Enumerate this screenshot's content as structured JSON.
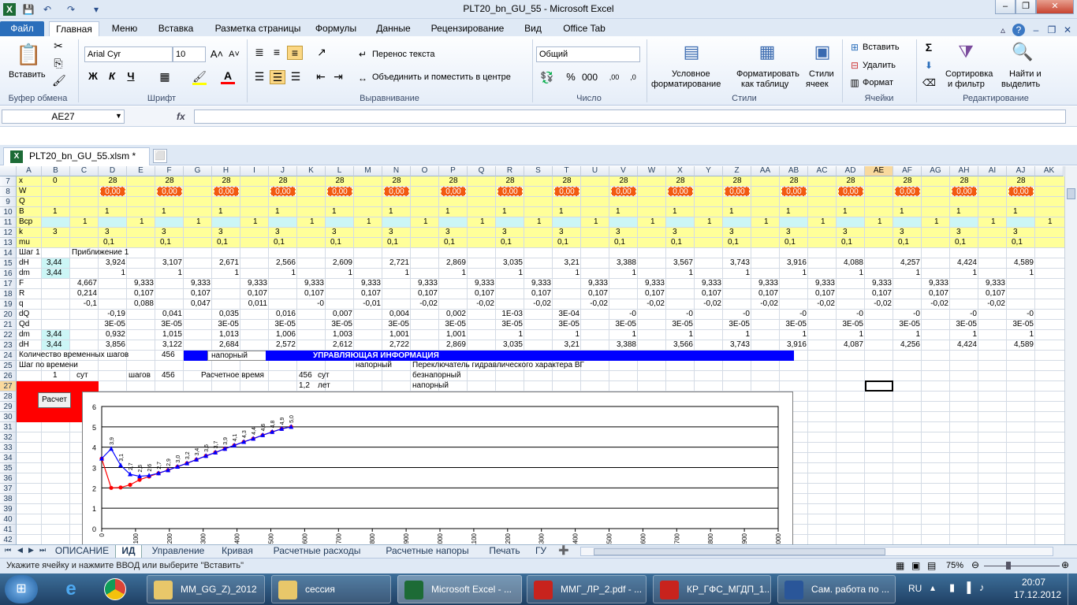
{
  "window": {
    "title": "PLT20_bn_GU_55 - Microsoft Excel"
  },
  "ribbon_tabs": [
    "Файл",
    "Главная",
    "Меню",
    "Вставка",
    "Разметка страницы",
    "Формулы",
    "Данные",
    "Рецензирование",
    "Вид",
    "Office Tab"
  ],
  "ribbon": {
    "paste": "Вставить",
    "font_name": "Arial Cyr",
    "font_size": "10",
    "bold": "Ж",
    "italic": "К",
    "underline": "Ч",
    "wrap_text": "Перенос текста",
    "merge_center": "Объединить и поместить в центре",
    "number_format": "Общий",
    "cond_format": [
      "Условное",
      "форматирование"
    ],
    "format_table": [
      "Форматировать",
      "как таблицу"
    ],
    "cell_styles": [
      "Стили",
      "ячеек"
    ],
    "insert": "Вставить",
    "delete": "Удалить",
    "format": "Формат",
    "sort_filter": [
      "Сортировка",
      "и фильтр"
    ],
    "find_select": [
      "Найти и",
      "выделить"
    ],
    "groups": [
      "Буфер обмена",
      "Шрифт",
      "Выравнивание",
      "Число",
      "Стили",
      "Ячейки",
      "Редактирование"
    ]
  },
  "formula_bar": {
    "name_box": "AE27",
    "fx": "fx",
    "value": ""
  },
  "doc_tab": {
    "label": "PLT20_bn_GU_55.xlsm *"
  },
  "columns": [
    "A",
    "B",
    "C",
    "D",
    "E",
    "F",
    "G",
    "H",
    "I",
    "J",
    "K",
    "L",
    "M",
    "N",
    "O",
    "P",
    "Q",
    "R",
    "S",
    "T",
    "U",
    "V",
    "W",
    "X",
    "Y",
    "Z",
    "AA",
    "AB",
    "AC",
    "AD",
    "AE",
    "AF",
    "AG",
    "AH",
    "AI",
    "AJ",
    "AK"
  ],
  "rows": [
    "7",
    "8",
    "9",
    "10",
    "11",
    "12",
    "13",
    "14",
    "15",
    "16",
    "17",
    "18",
    "19",
    "20",
    "21",
    "22",
    "23",
    "24",
    "25",
    "26",
    "27",
    "28",
    "29",
    "30",
    "31",
    "32",
    "33",
    "34",
    "35",
    "36",
    "37",
    "38",
    "39",
    "40",
    "41",
    "42",
    "43"
  ],
  "row_labels": {
    "r7": "x",
    "r8": "W",
    "r9": "Q",
    "r10": "B",
    "r11": "Bcp",
    "r12": "k",
    "r13": "mu",
    "r14": "Шаг 1",
    "r15": "dH",
    "r16": "dm",
    "r17": "F",
    "r18": "R",
    "r19": "q",
    "r20": "dQ",
    "r21": "Qd",
    "r22": "dm",
    "r23": "dH",
    "r24": "Количество временных шагов",
    "r25": "Шаг по времени"
  },
  "cells": {
    "x_b": "0",
    "x_val": "28",
    "w_val": "0,00",
    "b_val": "1",
    "bcp_val": "1",
    "k_val": "3",
    "mu_val": "0,1",
    "approx": "Приближение 1",
    "b15": "3,44",
    "b16": "3,44",
    "b22": "3,44",
    "b23": "3,44",
    "steps_count": "456",
    "dropdown": "напорный",
    "control_header": "УПРАВЛЯЮЩАЯ ИНФОРМАЦИЯ",
    "r25_n": "напорный",
    "r25_p": "Переключатель гидравлического характера ВГ",
    "r26_b": "1",
    "r26_c": "сут",
    "r26_e": "шагов",
    "r26_f": "456",
    "r26_h": "Расчетное время",
    "r26_k": "456",
    "r26_l": "сут",
    "r26_p": "безнапорный",
    "r27_k": "1,2",
    "r27_l": "лет",
    "r27_p": "напорный",
    "calc_button": "Расчет"
  },
  "row15": [
    "3,924",
    "3,107",
    "2,671",
    "2,566",
    "2,609",
    "2,721",
    "2,869",
    "3,035",
    "3,21",
    "3,388",
    "3,567",
    "3,743",
    "3,916",
    "4,088",
    "4,257",
    "4,424",
    "4,589"
  ],
  "row16": [
    "1",
    "1",
    "1",
    "1",
    "1",
    "1",
    "1",
    "1",
    "1",
    "1",
    "1",
    "1",
    "1",
    "1",
    "1",
    "1",
    "1"
  ],
  "row17": [
    "4,667",
    "9,333",
    "9,333",
    "9,333",
    "9,333",
    "9,333",
    "9,333",
    "9,333",
    "9,333",
    "9,333",
    "9,333",
    "9,333",
    "9,333",
    "9,333",
    "9,333",
    "9,333",
    "9,333"
  ],
  "row18": [
    "0,214",
    "0,107",
    "0,107",
    "0,107",
    "0,107",
    "0,107",
    "0,107",
    "0,107",
    "0,107",
    "0,107",
    "0,107",
    "0,107",
    "0,107",
    "0,107",
    "0,107",
    "0,107",
    "0,107"
  ],
  "row19": [
    "-0,1",
    "0,088",
    "0,047",
    "0,011",
    "-0",
    "-0,01",
    "-0,02",
    "-0,02",
    "-0,02",
    "-0,02",
    "-0,02",
    "-0,02",
    "-0,02",
    "-0,02",
    "-0,02",
    "-0,02",
    "-0,02"
  ],
  "row20": [
    "-0,19",
    "0,041",
    "0,035",
    "0,016",
    "0,007",
    "0,004",
    "0,002",
    "1E-03",
    "3E-04",
    "-0",
    "-0",
    "-0",
    "-0",
    "-0",
    "-0",
    "-0",
    "-0"
  ],
  "row21": [
    "3E-05",
    "3E-05",
    "3E-05",
    "3E-05",
    "3E-05",
    "3E-05",
    "3E-05",
    "3E-05",
    "3E-05",
    "3E-05",
    "3E-05",
    "3E-05",
    "3E-05",
    "3E-05",
    "3E-05",
    "3E-05",
    "3E-05"
  ],
  "row22": [
    "0,932",
    "1,015",
    "1,013",
    "1,006",
    "1,003",
    "1,001",
    "1,001",
    "1",
    "1",
    "1",
    "1",
    "1",
    "1",
    "1",
    "1",
    "1",
    "1"
  ],
  "row23": [
    "3,856",
    "3,122",
    "2,684",
    "2,572",
    "2,612",
    "2,722",
    "2,869",
    "3,035",
    "3,21",
    "3,388",
    "3,566",
    "3,743",
    "3,916",
    "4,087",
    "4,256",
    "4,424",
    "4,589"
  ],
  "chart_data": {
    "type": "line",
    "ylim": [
      0,
      6
    ],
    "yticks": [
      "0",
      "1",
      "2",
      "3",
      "4",
      "5",
      "6"
    ],
    "xticks": [
      "0",
      "100",
      "200",
      "300",
      "400",
      "500",
      "600",
      "700",
      "800",
      "900",
      "1000",
      "1100",
      "1200",
      "1300",
      "1400",
      "1500",
      "1600",
      "1700",
      "1800",
      "1900",
      "2000"
    ],
    "grid": true,
    "legend": "none",
    "series": [
      {
        "color": "#0000ff",
        "marker": "triangle",
        "x": [
          0,
          28,
          56,
          84,
          112,
          140,
          168,
          196,
          224,
          252,
          280,
          308,
          336,
          364,
          392,
          420,
          448,
          476,
          504,
          532,
          560
        ],
        "y": [
          3.44,
          3.92,
          3.11,
          2.67,
          2.57,
          2.61,
          2.72,
          2.87,
          3.04,
          3.21,
          3.39,
          3.57,
          3.74,
          3.92,
          4.09,
          4.26,
          4.42,
          4.59,
          4.75,
          4.9,
          5.0
        ]
      },
      {
        "color": "#ff0000",
        "marker": "circle",
        "x": [
          0,
          28,
          56,
          84,
          112,
          140,
          168,
          196,
          224,
          252,
          280,
          308,
          336,
          364,
          392,
          420,
          448,
          476,
          504,
          532,
          560
        ],
        "y": [
          3.44,
          2.0,
          2.02,
          2.15,
          2.4,
          2.56,
          2.72,
          2.87,
          3.04,
          3.21,
          3.39,
          3.57,
          3.74,
          3.92,
          4.09,
          4.26,
          4.42,
          4.59,
          4.75,
          4.9,
          5.0
        ]
      }
    ],
    "data_labels": [
      "3,9",
      "3,1",
      "2,7",
      "2,6",
      "2,6",
      "2,7",
      "2,9",
      "3,0",
      "3,2",
      "3,4",
      "3,6",
      "3,7",
      "3,9",
      "4,1",
      "4,3",
      "4,4",
      "4,6",
      "4,8",
      "4,9",
      "5,0"
    ]
  },
  "sheet_tabs": [
    "ОПИСАНИЕ",
    "ИД",
    "Управление",
    "Кривая",
    "Расчетные расходы",
    "Расчетные напоры",
    "Печать",
    "ГУ"
  ],
  "active_sheet": "ИД",
  "status": {
    "text": "Укажите ячейку и нажмите ВВОД или выберите \"Вставить\"",
    "zoom": "75%"
  },
  "taskbar": {
    "items": [
      "MM_GG_Z)_2012",
      "сессия",
      "Microsoft Excel - ...",
      "ММГ_ЛР_2.pdf - ...",
      "КР_ГФС_МГДП_1...",
      "Сам. работа по ..."
    ],
    "lang": "RU",
    "time": "20:07",
    "date": "17.12.2012"
  }
}
